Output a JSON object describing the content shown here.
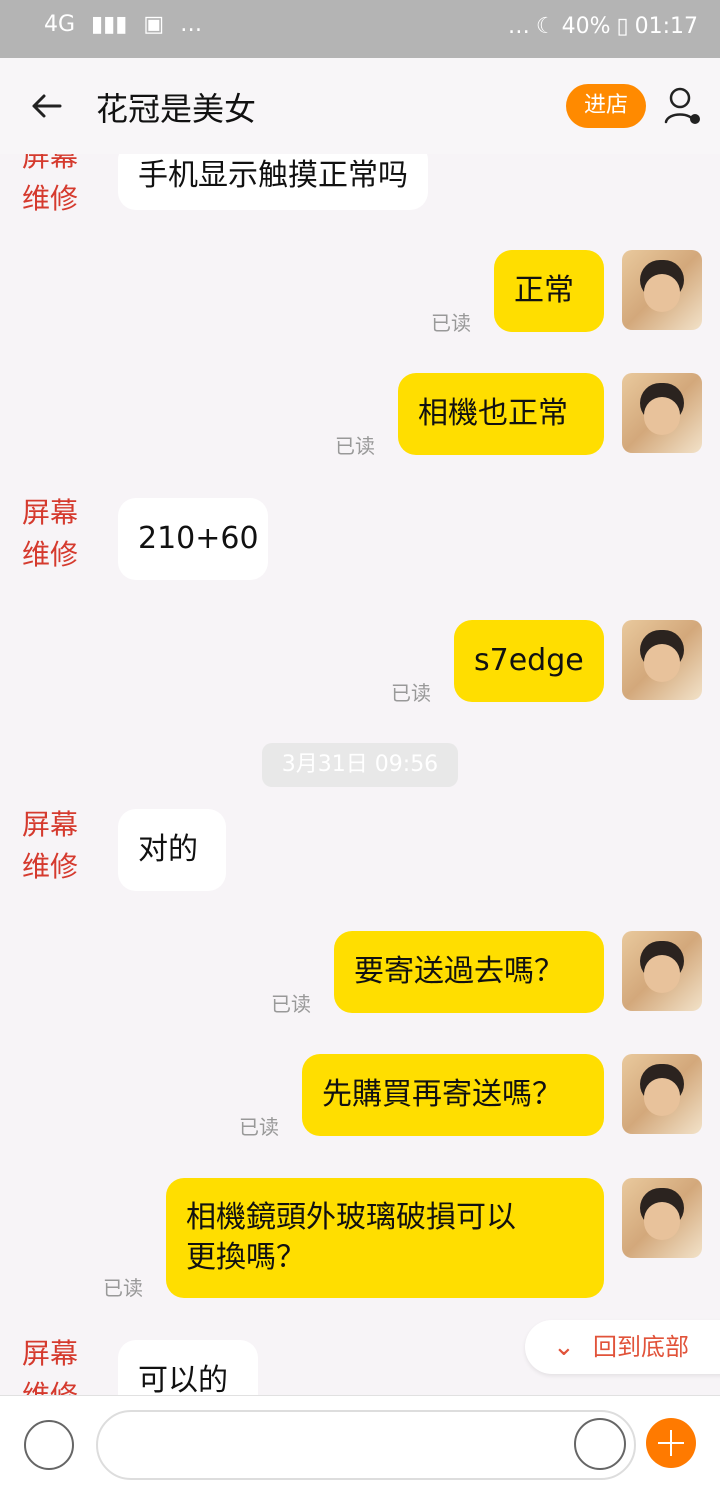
{
  "statusbar": {
    "left_text": "4G",
    "battery": "40%",
    "time": "01:17"
  },
  "header": {
    "title": "花冠是美女",
    "shop_button": "进店"
  },
  "chat": {
    "partner_name_top": "屏幕",
    "partner_name_bottom": "维修",
    "messages": [
      {
        "side": "left",
        "text": "手机显示触摸正常吗"
      },
      {
        "side": "right",
        "text": "正常",
        "read": "已读"
      },
      {
        "side": "right",
        "text": "相機也正常",
        "read": "已读"
      },
      {
        "side": "left",
        "text": "210+60"
      },
      {
        "side": "right",
        "text": "s7edge",
        "read": "已读"
      },
      {
        "timestamp": "3月31日 09:56"
      },
      {
        "side": "left",
        "text": "对的"
      },
      {
        "side": "right",
        "text": "要寄送過去嗎？",
        "read": "已读"
      },
      {
        "side": "right",
        "text": "先購買再寄送嗎？",
        "read": "已读"
      },
      {
        "side": "right",
        "text": "相機鏡頭外玻璃破損可以\n更換嗎？",
        "read": "已读"
      },
      {
        "side": "left",
        "text": "可以的"
      }
    ]
  },
  "overlay": {
    "back_to_bottom": "回到底部"
  },
  "composer": {
    "placeholder": ""
  }
}
